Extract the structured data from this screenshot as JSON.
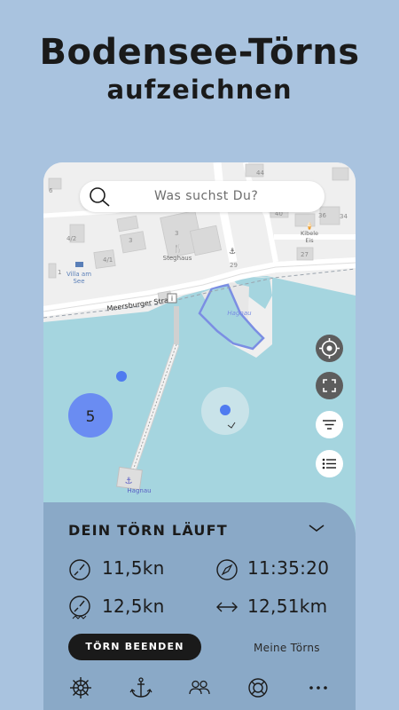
{
  "headline": {
    "line1": "Bodensee-Törns",
    "line2": "aufzeichnen"
  },
  "search": {
    "placeholder": "Was suchst Du?"
  },
  "map": {
    "labels": {
      "steghaus": "Steghaus",
      "villa": "Villa am\nSee",
      "villa_l1": "Villa am",
      "villa_l2": "See",
      "street": "Meersburger Straße",
      "hagnau_harbor": "Hagnau",
      "hagnau_pier": "Hagnau",
      "kibele_l1": "Kibele",
      "kibele_l2": "Eis"
    },
    "house_numbers": [
      "44",
      "40",
      "36",
      "34",
      "27",
      "29",
      "4/2",
      "3",
      "4/1",
      "6",
      "1",
      "3"
    ],
    "cluster_count": "5",
    "colors": {
      "water": "#a5d5df",
      "land": "#efefef",
      "marker": "#4f7bf0",
      "cluster": "#6a8cf2"
    }
  },
  "map_controls": {
    "locate_icon": "crosshair-icon",
    "fullscreen_icon": "fullscreen-icon",
    "filter_icon": "filter-icon",
    "list_icon": "list-icon"
  },
  "panel": {
    "title": "DEIN TÖRN LÄUFT",
    "stats": {
      "speed": "11,5kn",
      "time": "11:35:20",
      "wind": "12,5kn",
      "distance": "12,51km"
    },
    "end_button": "TÖRN BEENDEN",
    "my_trips_link": "Meine Törns",
    "colors": {
      "panel_bg": "#8aa9c7",
      "button_bg": "#1a1a1a"
    }
  },
  "bottom_nav": {
    "items": [
      "helm-icon",
      "anchor-icon",
      "people-icon",
      "lifebuoy-icon",
      "more-icon"
    ],
    "active": "helm-icon"
  }
}
